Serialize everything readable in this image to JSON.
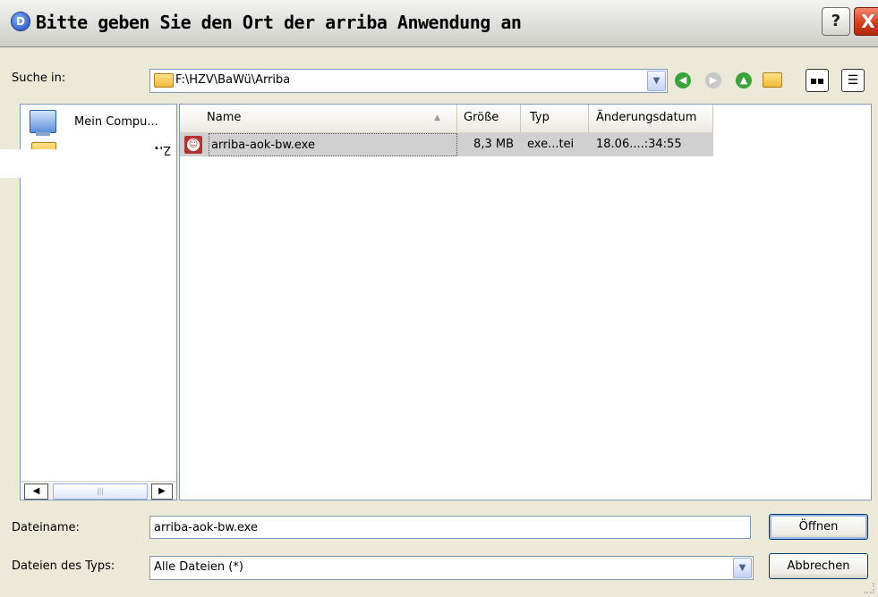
{
  "window": {
    "title": "Bitte geben Sie den Ort der arriba Anwendung an",
    "help_label": "?",
    "close_label": "X"
  },
  "look_in": {
    "label": "Suche in:",
    "value": "F:\\HZV\\BaWü\\Arriba"
  },
  "places": [
    {
      "label": "Mein Compu...",
      "icon": "my-computer-icon"
    },
    {
      "label": "NZ",
      "icon": "folder-icon"
    }
  ],
  "file_list": {
    "columns": [
      "Name",
      "Größe",
      "Typ",
      "Änderungsdatum"
    ],
    "rows": [
      {
        "name": "arriba-aok-bw.exe",
        "size": "8,3 MB",
        "type": "exe...tei",
        "modified": "18.06....:34:55"
      }
    ]
  },
  "file_name": {
    "label": "Dateiname:",
    "value": "arriba-aok-bw.exe"
  },
  "file_type": {
    "label": "Dateien des Typs:",
    "value": "Alle Dateien (*)"
  },
  "buttons": {
    "open": "Öffnen",
    "cancel": "Abbrechen"
  },
  "colors": {
    "dialog_bg": "#ece9d8",
    "selection": "#d0d0d0",
    "border": "#7f9db9",
    "close": "#d2391a"
  }
}
